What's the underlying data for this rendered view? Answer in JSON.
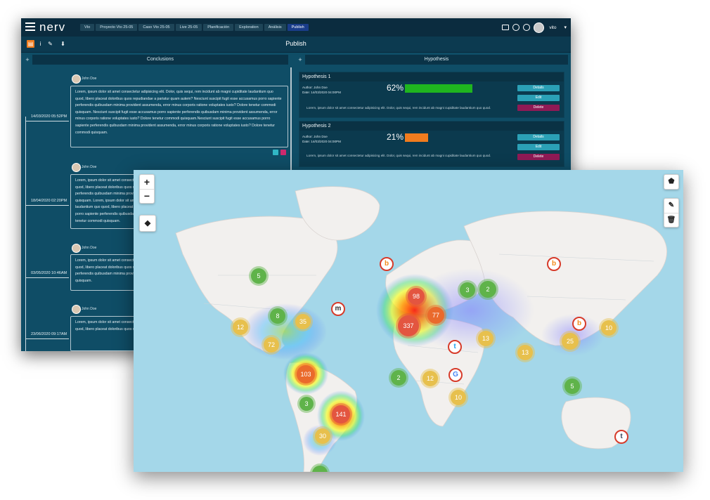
{
  "app": {
    "logo": "nerv",
    "breadcrumbs": [
      "Vto",
      "Proyecto Vto 25-05",
      "Caso Vto 25-05",
      "Live 25-05",
      "Planificación",
      "Exploration",
      "Análisis",
      "Publish"
    ],
    "user": "vito",
    "page_title": "Publish",
    "conclusions_header": "Conclusions",
    "hypothesis_header": "Hypothesis",
    "plus": "+",
    "caret": "▾"
  },
  "conclusions": [
    {
      "author": "John Doe",
      "date": "14/03/2020 05:52PM",
      "text": "Lorem, ipsum dolor sit amet consectetur adipisicing elit. Dolor, quis sequi, rem incidunt ab magni cupiditate laudantium quo quod, libero placeat doloribus quos repudiandae a pariatur quam autem? Nesciunt suscipit fugit esse accusamus porro sapiente perferendis quibusdam minima provident assumenda, error minus corporis ratione voluptates iusto? Dolore tenetur commodi quisquam. Nesciunt suscipit fugit esse accusamus porro sapiente perferendis quibusdam minima provident assumenda, error minus corporis ratione voluptates iusto? Dolore tenetur commodi quisquam.Nesciunt suscipit fugit esse accusamus porro sapiente perferendis quibusdam minima provident assumenda, error minus corporis ratione voluptates iusto? Dolore tenetur commodi quisquam."
    },
    {
      "author": "John Doe",
      "date": "18/04/2020 02:20PM",
      "text": "Lorem, ipsum dolor sit amet consectetur adipisicing elit. Dolor, quis sequi, rem incidunt ab magni cupiditate laudantium quo quod, libero placeat doloribus quos repudiandae a pariatur quam autem? Nesciunt suscipit fugit esse accusamus porro sapiente perferendis quibusdam minima provident assumenda, error minus corporis ratione voluptates iusto? Dolore tenetur commodi quisquam. Lorem, ipsum dolor sit amet consectetur adipisicing elit. Dolor, quis sequi, rem incidunt ab magni cupiditate laudantium quo quod, libero placeat doloribus quos repudiandae a pariatur quam autem? Nesciunt suscipit fugit esse accusamus porro sapiente perferendis quibusdam minima provident assumenda, error minus corporis ratione voluptates iusto? Dolore tenetur commodi quisquam."
    },
    {
      "author": "John Doe",
      "date": "03/05/2020 10:46AM",
      "text": "Lorem, ipsum dolor sit amet consectetur adipisicing elit. Dolor, quis sequi, rem incidunt ab magni cupiditate laudantium quo quod, libero placeat doloribus quos repudiandae a pariatur quam autem? Nesciunt suscipit fugit esse accusamus porro sapiente perferendis quibusdam minima provident assumenda, error minus corporis ratione voluptates iusto? Dolore tenetur commodi quisquam."
    },
    {
      "author": "John Doe",
      "date": "23/06/2020 09:17AM",
      "text": "Lorem, ipsum dolor sit amet consectetur adipisicing elit. Dolor, quis sequi, rem incidunt ab magni cupiditate laudantium quo quod, libero placeat doloribus quos repudiandae a pariatur quam autem?"
    }
  ],
  "hypotheses": [
    {
      "title": "Hypothesis 1",
      "author": "Author: John Doe",
      "date": "Date: 14/03/2020 04:00PM",
      "percent": "62%",
      "fraction": 0.62,
      "bar_color": "#1fb51f",
      "text": "Lorem, ipsum dolor sit amet consectetur adipisicing elit. Dolor, quis sequi, rem incidunt ab magni cupiditate laudantium quo quod.",
      "details": "Details",
      "edit": "Edit",
      "delete": "Delete"
    },
    {
      "title": "Hypothesis 2",
      "author": "Author: John Doe",
      "date": "Date: 14/03/2020 04:00PM",
      "percent": "21%",
      "fraction": 0.21,
      "bar_color": "#f07c1e",
      "text": "Lorem, ipsum dolor sit amet consectetur adipisicing elit. Dolor, quis sequi, rem incidunt ab magni cupiditate laudantium quo quod.",
      "details": "Details",
      "edit": "Edit",
      "delete": "Delete"
    }
  ],
  "map": {
    "zoom_in": "+",
    "zoom_out": "−",
    "clusters": [
      {
        "value": "5",
        "color": "green"
      },
      {
        "value": "8",
        "color": "green"
      },
      {
        "value": "12",
        "color": "yellow"
      },
      {
        "value": "35",
        "color": "yellow"
      },
      {
        "value": "72",
        "color": "yellow"
      },
      {
        "value": "103",
        "color": "orange"
      },
      {
        "value": "3",
        "color": "green"
      },
      {
        "value": "141",
        "color": "red"
      },
      {
        "value": "30",
        "color": "yellow"
      },
      {
        "value": "98",
        "color": "red"
      },
      {
        "value": "77",
        "color": "orange"
      },
      {
        "value": "337",
        "color": "red"
      },
      {
        "value": "3",
        "color": "green"
      },
      {
        "value": "2",
        "color": "green"
      },
      {
        "value": "13",
        "color": "yellow"
      },
      {
        "value": "13",
        "color": "yellow"
      },
      {
        "value": "2",
        "color": "green"
      },
      {
        "value": "12",
        "color": "yellow"
      },
      {
        "value": "10",
        "color": "yellow"
      },
      {
        "value": "25",
        "color": "yellow"
      },
      {
        "value": "10",
        "color": "yellow"
      },
      {
        "value": "5",
        "color": "green"
      }
    ],
    "source_markers": [
      {
        "icon": "bing-icon",
        "glyph": "b",
        "color": "#f28c1b"
      },
      {
        "icon": "bing-icon",
        "glyph": "b",
        "color": "#f28c1b"
      },
      {
        "icon": "bing-icon",
        "glyph": "b",
        "color": "#f28c1b"
      },
      {
        "icon": "twitter-icon",
        "glyph": "t",
        "color": "#1da1f2"
      },
      {
        "icon": "google-icon",
        "glyph": "G",
        "color": "#4285f4"
      },
      {
        "icon": "tumblr-icon",
        "glyph": "t",
        "color": "#35465c"
      },
      {
        "icon": "news-icon",
        "glyph": "m",
        "color": "#333333"
      }
    ]
  }
}
